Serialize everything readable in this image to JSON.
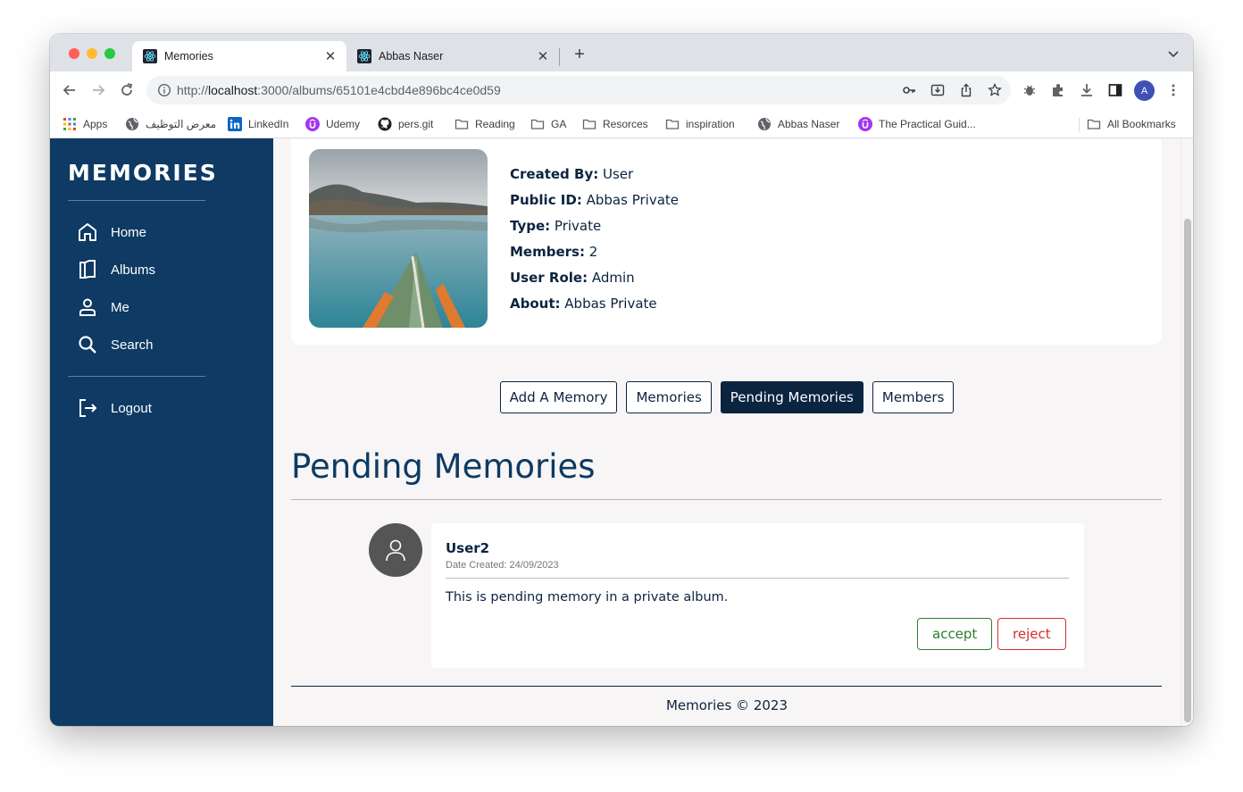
{
  "browser": {
    "tabs": [
      {
        "title": "Memories",
        "active": true
      },
      {
        "title": "Abbas Naser",
        "active": false
      }
    ],
    "url": {
      "scheme": "http://",
      "host": "localhost",
      "path": ":3000/albums/65101e4cbd4e896bc4ce0d59"
    },
    "profile_initial": "A",
    "bookmarks": [
      {
        "label": "Apps",
        "icon": "apps-grid-icon"
      },
      {
        "label": "معرض التوظيف",
        "icon": "globe-icon"
      },
      {
        "label": "LinkedIn",
        "icon": "linkedin-icon"
      },
      {
        "label": "Udemy",
        "icon": "udemy-icon"
      },
      {
        "label": "pers.git",
        "icon": "github-icon"
      },
      {
        "label": "Reading",
        "icon": "folder-icon"
      },
      {
        "label": "GA",
        "icon": "folder-icon"
      },
      {
        "label": "Resorces",
        "icon": "folder-icon"
      },
      {
        "label": "inspiration",
        "icon": "folder-icon"
      },
      {
        "label": "Abbas Naser",
        "icon": "globe-icon"
      },
      {
        "label": "The Practical Guid...",
        "icon": "udemy-icon"
      },
      {
        "label": "All Bookmarks",
        "icon": "folder-icon"
      }
    ]
  },
  "sidebar": {
    "brand": "MEMORIES",
    "items": [
      {
        "label": "Home",
        "icon": "home-icon"
      },
      {
        "label": "Albums",
        "icon": "albums-icon"
      },
      {
        "label": "Me",
        "icon": "person-icon"
      },
      {
        "label": "Search",
        "icon": "search-icon"
      }
    ],
    "logout": {
      "label": "Logout",
      "icon": "logout-icon"
    }
  },
  "album": {
    "details": [
      {
        "key": "Created By:",
        "value": "User"
      },
      {
        "key": "Public ID:",
        "value": "Abbas Private"
      },
      {
        "key": "Type:",
        "value": "Private"
      },
      {
        "key": "Members:",
        "value": "2"
      },
      {
        "key": "User Role:",
        "value": "Admin"
      },
      {
        "key": "About:",
        "value": "Abbas Private"
      }
    ]
  },
  "album_tabs": [
    {
      "label": "Add A Memory",
      "active": false
    },
    {
      "label": "Memories",
      "active": false
    },
    {
      "label": "Pending Memories",
      "active": true
    },
    {
      "label": "Members",
      "active": false
    }
  ],
  "pending": {
    "title": "Pending Memories",
    "memories": [
      {
        "user": "User2",
        "date_created": "Date Created: 24/09/2023",
        "text": "This is pending memory in a private album.",
        "accept_label": "accept",
        "reject_label": "reject"
      }
    ]
  },
  "footer": {
    "text": "Memories © 2023"
  },
  "colors": {
    "sidebar": "#0e3a63",
    "accent": "#0b2440",
    "accept": "#2e7d32",
    "reject": "#d32f2f"
  }
}
